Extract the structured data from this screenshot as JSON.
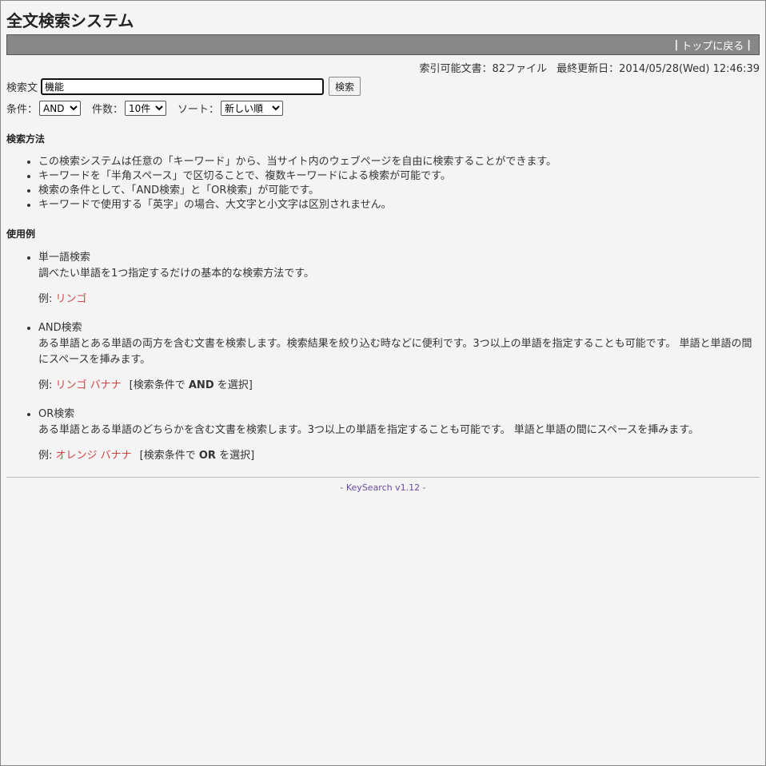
{
  "page": {
    "title": "全文検索システム",
    "top_link": "トップに戻る",
    "separator": "|"
  },
  "meta": {
    "doc_count": "索引可能文書：82ファイル",
    "updated": "最終更新日：2014/05/28(Wed) 12:46:39"
  },
  "search": {
    "label": "検索文",
    "value": "機能",
    "button": "検索"
  },
  "options": {
    "condition_label": "条件：",
    "condition_value": "AND",
    "count_label": "件数：",
    "count_value": "10件",
    "sort_label": "ソート：",
    "sort_value": "新しい順"
  },
  "method": {
    "heading": "検索方法",
    "items": [
      "この検索システムは任意の「キーワード」から、当サイト内のウェブページを自由に検索することができます。",
      "キーワードを「半角スペース」で区切ることで、複数キーワードによる検索が可能です。",
      "検索の条件として、「AND検索」と「OR検索」が可能です。",
      "キーワードで使用する「英字」の場合、大文字と小文字は区別されません。"
    ]
  },
  "examples": {
    "heading": "使用例",
    "example_prefix": "例: ",
    "items": [
      {
        "title": "単一語検索",
        "desc": "調べたい単語を1つ指定するだけの基本的な検索方法です。",
        "keyword": "リンゴ",
        "note_pre": "",
        "note_bold": "",
        "note_post": ""
      },
      {
        "title": "AND検索",
        "desc": "ある単語とある単語の両方を含む文書を検索します。検索結果を絞り込む時などに便利です。3つ以上の単語を指定することも可能です。 単語と単語の間にスペースを挿みます。",
        "keyword": "リンゴ バナナ",
        "note_pre": "[検索条件で ",
        "note_bold": "AND",
        "note_post": " を選択]"
      },
      {
        "title": "OR検索",
        "desc": "ある単語とある単語のどちらかを含む文書を検索します。3つ以上の単語を指定することも可能です。 単語と単語の間にスペースを挿みます。",
        "keyword": "オレンジ バナナ",
        "note_pre": "[検索条件で ",
        "note_bold": "OR",
        "note_post": " を選択]"
      }
    ]
  },
  "footer": {
    "dash_left": "- ",
    "link": "KeySearch v1.12",
    "dash_right": " -"
  }
}
